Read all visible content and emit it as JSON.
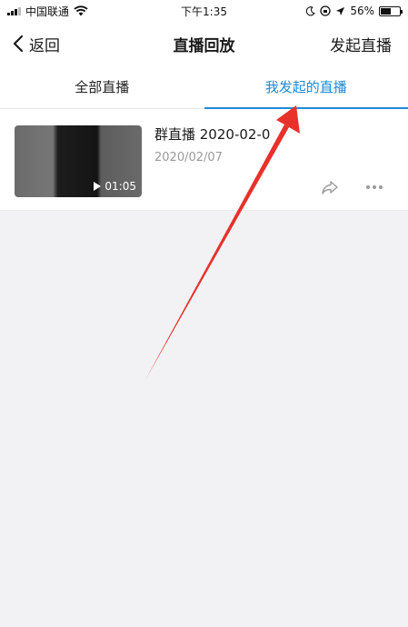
{
  "status_bar": {
    "carrier": "中国联通",
    "time": "下午1:35",
    "battery": "56%"
  },
  "nav": {
    "back_label": "返回",
    "title": "直播回放",
    "action_label": "发起直播"
  },
  "tabs": [
    {
      "label": "全部直播",
      "active": false
    },
    {
      "label": "我发起的直播",
      "active": true
    }
  ],
  "items": [
    {
      "title": "群直播 2020-02-0",
      "date": "2020/02/07",
      "duration": "01:05"
    }
  ],
  "colors": {
    "accent": "#1e8ad6",
    "annotation_arrow": "#e8312a"
  }
}
